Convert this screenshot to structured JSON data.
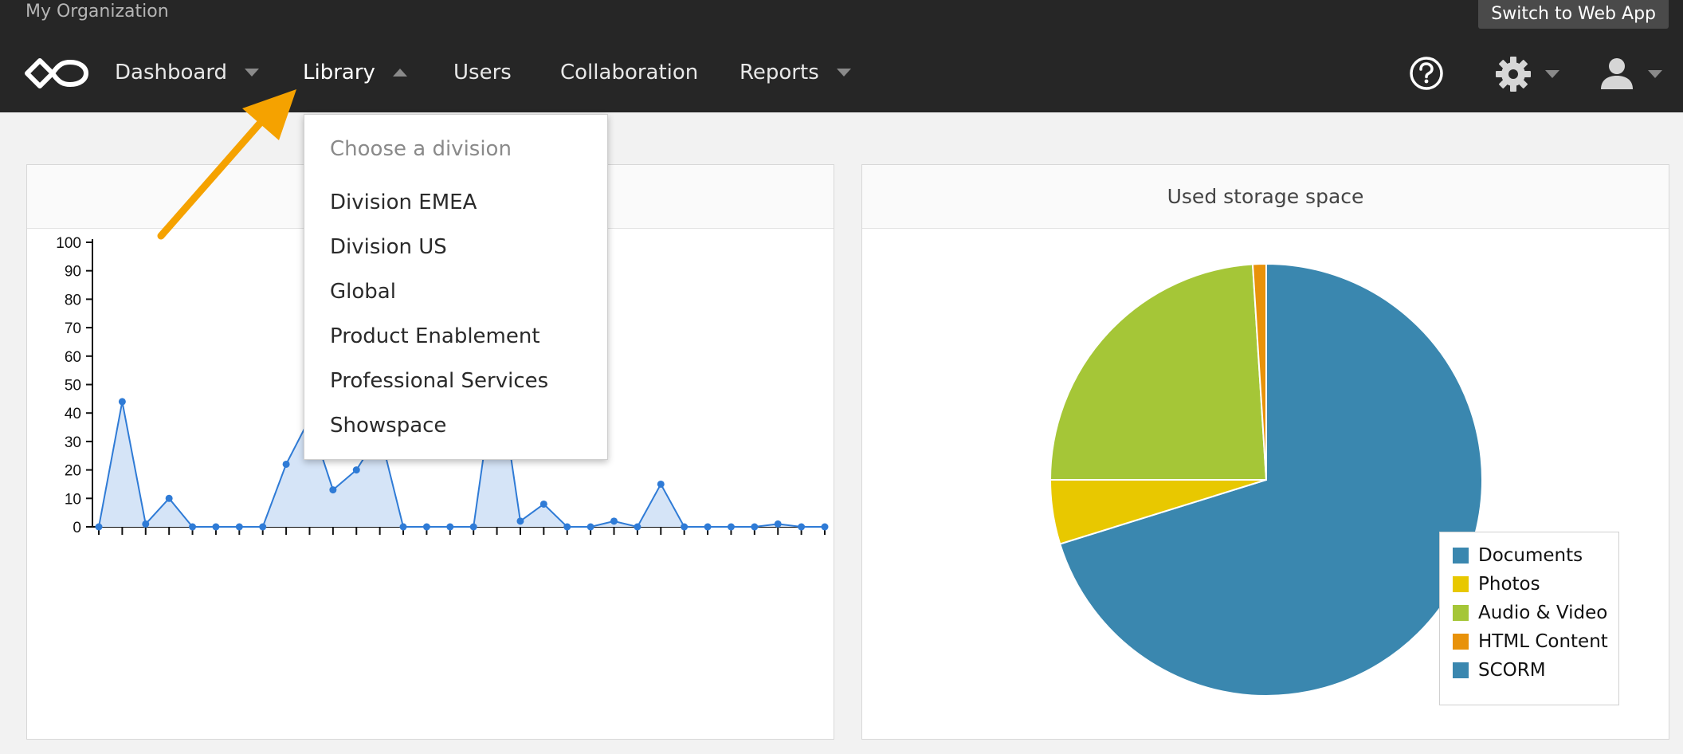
{
  "header": {
    "org_name": "My Organization",
    "switch_label": "Switch to Web App"
  },
  "nav": [
    {
      "label": "Dashboard",
      "caret": "down"
    },
    {
      "label": "Library",
      "caret": "up"
    },
    {
      "label": "Users"
    },
    {
      "label": "Collaboration"
    },
    {
      "label": "Reports",
      "caret": "down"
    }
  ],
  "icons": [
    "logo-infinity-icon",
    "help-icon",
    "gear-icon",
    "user-icon",
    "chevron-down-icon"
  ],
  "dropdown": {
    "header": "Choose a division",
    "items": [
      "Division EMEA",
      "Division US",
      "Global",
      "Product Enablement",
      "Professional Services",
      "Showspace"
    ]
  },
  "storage_panel": {
    "title": "Used storage space"
  },
  "colors": {
    "topbar": "#262626",
    "line": "#2f7bd6",
    "area": "#d5e4f7",
    "arrow": "#f5a200"
  },
  "chart_data": [
    {
      "type": "area",
      "title": "",
      "ylim": [
        0,
        100
      ],
      "yticks": [
        "0",
        "10",
        "20",
        "30",
        "40",
        "50",
        "60",
        "70",
        "80",
        "90",
        "100"
      ],
      "x": [
        0,
        1,
        2,
        3,
        4,
        5,
        6,
        7,
        8,
        9,
        10,
        11,
        12,
        13,
        14,
        15,
        16,
        17,
        18,
        19,
        20,
        21,
        22,
        23,
        24,
        25,
        26,
        27,
        28,
        29,
        30,
        31
      ],
      "series": [
        {
          "values": [
            0,
            44,
            1,
            10,
            0,
            0,
            0,
            0,
            22,
            38,
            13,
            20,
            33,
            0,
            0,
            0,
            0,
            58,
            2,
            8,
            0,
            0,
            2,
            0,
            15,
            0,
            0,
            0,
            0,
            1,
            0,
            0
          ]
        }
      ]
    },
    {
      "type": "pie",
      "title": "Used storage space",
      "legend_position": "bottom-right",
      "slices": [
        {
          "label": "Documents",
          "value": 70.2,
          "color": "#3a87af"
        },
        {
          "label": "Photos",
          "value": 4.8,
          "color": "#e8c800"
        },
        {
          "label": "Audio & Video",
          "value": 24.0,
          "color": "#a5c637"
        },
        {
          "label": "HTML Content",
          "value": 1.0,
          "color": "#e8920a"
        },
        {
          "label": "SCORM",
          "value": 0,
          "color": "#3a87af"
        }
      ]
    }
  ]
}
